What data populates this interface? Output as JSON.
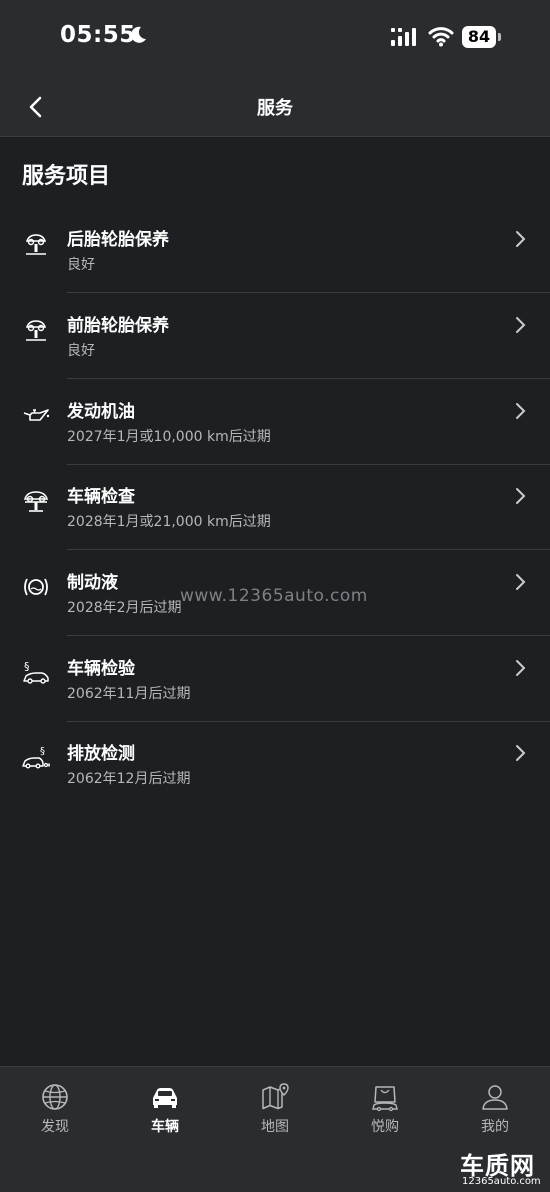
{
  "status": {
    "time": "05:55",
    "battery": "84"
  },
  "nav": {
    "title": "服务"
  },
  "section": {
    "title": "服务项目"
  },
  "items": [
    {
      "title": "后胎轮胎保养",
      "sub": "良好",
      "icon": "tire-lift-icon"
    },
    {
      "title": "前胎轮胎保养",
      "sub": "良好",
      "icon": "tire-lift-icon"
    },
    {
      "title": "发动机油",
      "sub": "2027年1月或10,000 km后过期",
      "icon": "oil-can-icon"
    },
    {
      "title": "车辆检查",
      "sub": "2028年1月或21,000 km后过期",
      "icon": "car-lift-icon"
    },
    {
      "title": "制动液",
      "sub": "2028年2月后过期",
      "icon": "brake-fluid-icon"
    },
    {
      "title": "车辆检验",
      "sub": "2062年11月后过期",
      "icon": "car-inspection-icon"
    },
    {
      "title": "排放检测",
      "sub": "2062年12月后过期",
      "icon": "emission-test-icon"
    }
  ],
  "watermark": "www.12365auto.com",
  "tabs": [
    {
      "label": "发现",
      "icon": "globe-icon"
    },
    {
      "label": "车辆",
      "icon": "car-icon"
    },
    {
      "label": "地图",
      "icon": "map-icon"
    },
    {
      "label": "悦购",
      "icon": "shopping-bag-icon"
    },
    {
      "label": "我的",
      "icon": "person-icon"
    }
  ],
  "logo": {
    "main": "车质网",
    "sub": "12365auto.com"
  }
}
